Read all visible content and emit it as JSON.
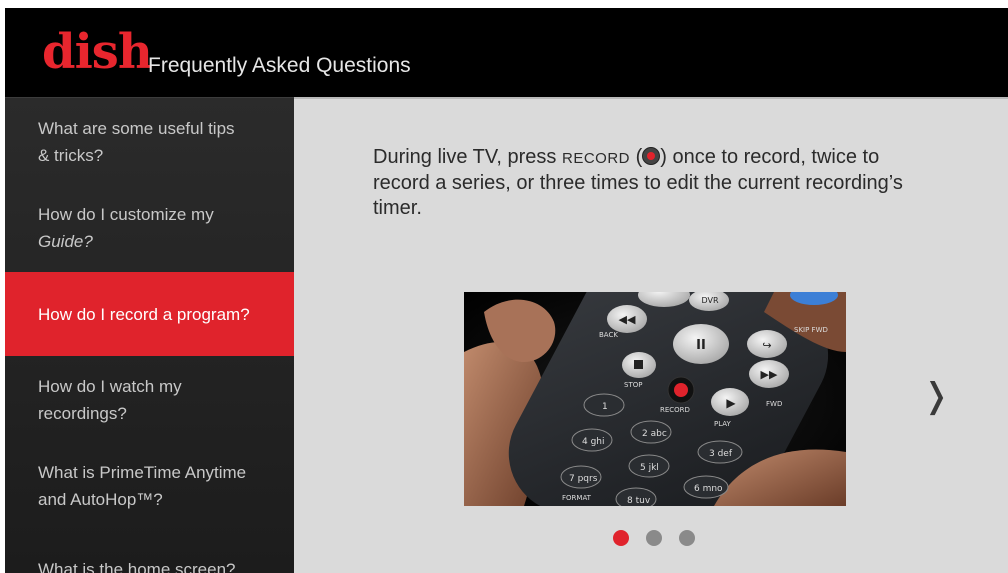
{
  "header": {
    "logo_text": "dish",
    "title": "Frequently Asked Questions"
  },
  "sidebar": {
    "items": [
      {
        "line1": "What are some useful tips",
        "line2": "& tricks?"
      },
      {
        "line1": "How do I customize my",
        "line2": "Guide?"
      },
      {
        "line1": "How do I record a program?",
        "active": true
      },
      {
        "line1": "How do I watch my",
        "line2": "recordings?"
      },
      {
        "line1": "What is PrimeTime Anytime",
        "line2": "and AutoHop™?"
      },
      {
        "line1": "What is the home screen?"
      }
    ]
  },
  "main": {
    "answer_part1": "During live TV, press ",
    "answer_keyword": "RECORD",
    "answer_part2": " once to record, twice to record a series, or three times to edit the current recording’s timer.",
    "paren_open": "(",
    "paren_close": ")",
    "image": {
      "remote_labels": {
        "dvr": "DVR",
        "back": "BACK",
        "skip_fwd": "SKIP FWD",
        "stop": "STOP",
        "record": "RECORD",
        "play": "PLAY",
        "fwd": "FWD",
        "format": "FORMAT",
        "keys": [
          "1",
          "2 abc",
          "3 def",
          "4 ghi",
          "5 jkl",
          "6 mno",
          "7 pqrs",
          "8 tuv"
        ]
      }
    },
    "next_arrow": "❭",
    "pagination": {
      "total": 3,
      "current": 1
    }
  },
  "colors": {
    "brand_red": "#e0232c",
    "header_bg": "#000000",
    "sidebar_bg": "#262626",
    "content_bg": "#dadada"
  }
}
